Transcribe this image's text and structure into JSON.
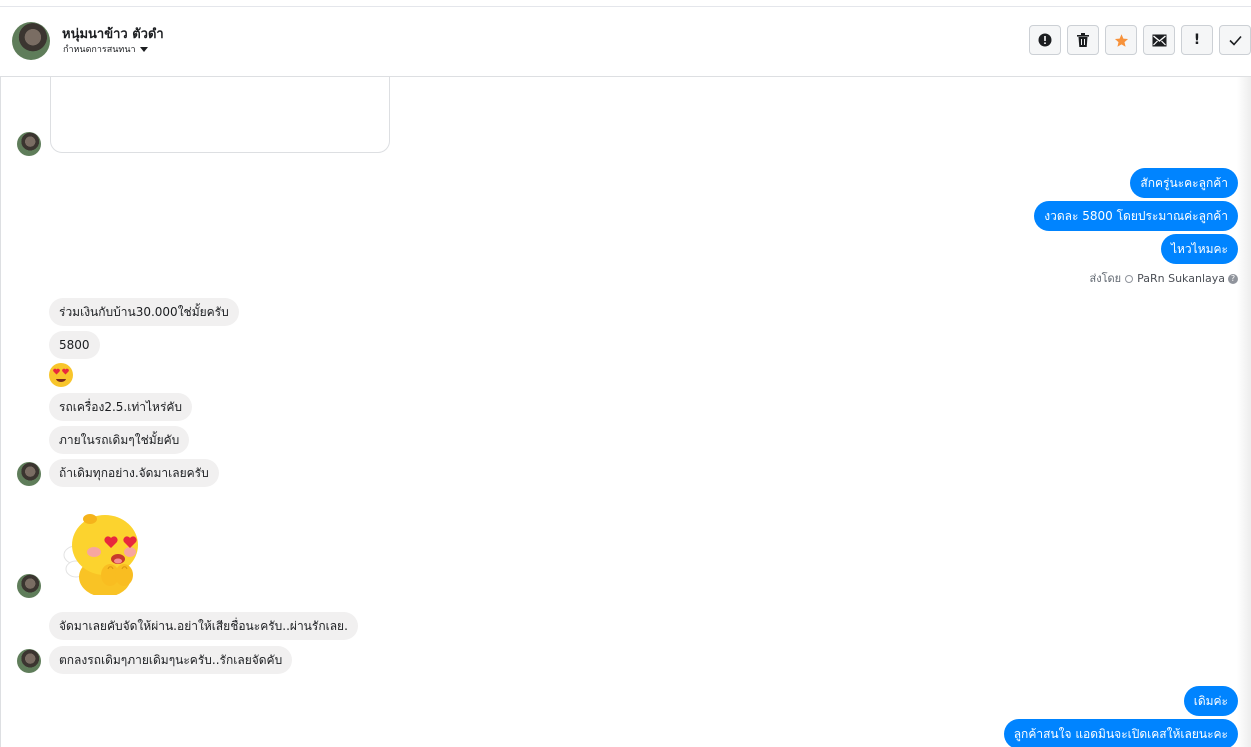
{
  "header": {
    "name": "หนุ่มนาข้าว ตัวดำ",
    "subtitle": "กำหนดการสนทนา"
  },
  "actions": [
    {
      "icon": "alert-icon",
      "glyph": "!"
    },
    {
      "icon": "trash-icon",
      "glyph": "🗑"
    },
    {
      "icon": "star-icon",
      "glyph": "★"
    },
    {
      "icon": "mail-icon",
      "glyph": "✉"
    },
    {
      "icon": "exclamation-icon",
      "glyph": "!"
    },
    {
      "icon": "check-icon",
      "glyph": "✓"
    }
  ],
  "messages_out_1": [
    "สักครู่นะคะลูกค้า",
    "งวดละ 5800  โดยประมาณค่ะลูกค้า",
    "ไหวไหมคะ"
  ],
  "sent_by": {
    "prefix": "ส่งโดย",
    "name": "PaRn Sukanlaya"
  },
  "messages_in_1": [
    "ร่วมเงินกับบ้าน30.000ใช่มั้ยครับ",
    "5800",
    "รถเครื่อง2.5.เท่าไหร่คับ",
    "ภายในรถเดิมๆใช่มั้ยคับ",
    "ถ้าเดิมทุกอย่าง.จัดมาเลยครับ"
  ],
  "messages_in_2": [
    "จัดมาเลยคับจัดให้ผ่าน.อย่าให้เสียชื่อนะครับ..ผ่านรักเลย.",
    "ตกลงรถเดิมๆภายเดิมๆนะครับ..รักเลยจัดคับ"
  ],
  "messages_out_2": [
    "เดิมค่ะ",
    "ลูกค้าสนใจ แอดมินจะเปิดเคสให้เลยนะคะ"
  ],
  "colors": {
    "outgoing": "#0084ff",
    "incoming": "#f1f0f0"
  }
}
